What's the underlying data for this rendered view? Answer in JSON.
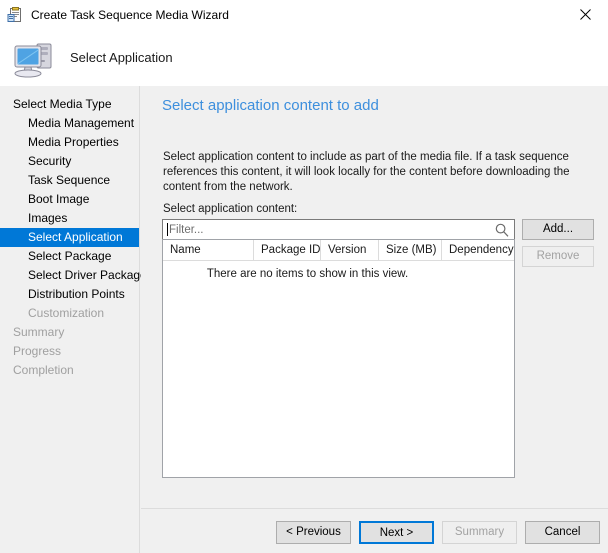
{
  "window": {
    "title": "Create Task Sequence Media Wizard",
    "icon": "wizard-clipboard-icon",
    "close_label": "✕"
  },
  "header": {
    "title": "Select Application",
    "icon": "computer-icon"
  },
  "sidebar": {
    "items": [
      {
        "label": "Select Media Type",
        "indent": false,
        "state": "normal"
      },
      {
        "label": "Media Management",
        "indent": true,
        "state": "normal"
      },
      {
        "label": "Media Properties",
        "indent": true,
        "state": "normal"
      },
      {
        "label": "Security",
        "indent": true,
        "state": "normal"
      },
      {
        "label": "Task Sequence",
        "indent": true,
        "state": "normal"
      },
      {
        "label": "Boot Image",
        "indent": true,
        "state": "normal"
      },
      {
        "label": "Images",
        "indent": true,
        "state": "normal"
      },
      {
        "label": "Select Application",
        "indent": true,
        "state": "selected"
      },
      {
        "label": "Select Package",
        "indent": true,
        "state": "normal"
      },
      {
        "label": "Select Driver Package",
        "indent": true,
        "state": "normal"
      },
      {
        "label": "Distribution Points",
        "indent": true,
        "state": "normal"
      },
      {
        "label": "Customization",
        "indent": true,
        "state": "disabled"
      },
      {
        "label": "Summary",
        "indent": false,
        "state": "disabled"
      },
      {
        "label": "Progress",
        "indent": false,
        "state": "disabled"
      },
      {
        "label": "Completion",
        "indent": false,
        "state": "disabled"
      }
    ]
  },
  "content": {
    "heading": "Select application content to add",
    "description": "Select application content to include as part of the media file. If a task sequence references this content, it will look locally for the content before downloading the content from the network.",
    "field_label": "Select application content:",
    "filter": {
      "placeholder": "Filter...",
      "value": "",
      "icon": "search-icon"
    },
    "list": {
      "columns": [
        "Name",
        "Package ID",
        "Version",
        "Size (MB)",
        "Dependency"
      ],
      "rows": [],
      "empty_message": "There are no items to show in this view."
    },
    "buttons": {
      "add": "Add...",
      "remove": "Remove"
    }
  },
  "footer": {
    "previous": "< Previous",
    "next": "Next >",
    "summary": "Summary",
    "cancel": "Cancel"
  },
  "colors": {
    "accent": "#0078d7",
    "heading": "#3d8fdd",
    "window_bg": "#f0f0f0",
    "disabled_text": "#a0a0a0"
  }
}
